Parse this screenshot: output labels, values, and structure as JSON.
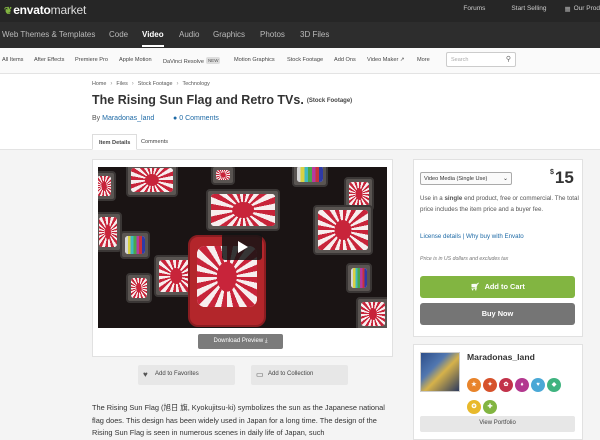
{
  "header": {
    "logo": "envato",
    "logo_suffix": "market",
    "links": [
      "Forums",
      "Start Selling",
      "Our Prod"
    ]
  },
  "categories": [
    "Web Themes & Templates",
    "Code",
    "Video",
    "Audio",
    "Graphics",
    "Photos",
    "3D Files"
  ],
  "active_category": "Video",
  "subnav": {
    "items": [
      "All Items",
      "After Effects",
      "Premiere Pro",
      "Apple Motion",
      "DaVinci Resolve",
      "Motion Graphics",
      "Stock Footage",
      "Add Ons",
      "Video Maker",
      "More"
    ],
    "new_badge": "NEW",
    "video_maker_suffix": "↗",
    "search_placeholder": "Search"
  },
  "breadcrumbs": [
    "Home",
    "Files",
    "Stock Footage",
    "Technology"
  ],
  "item": {
    "title": "The Rising Sun Flag and Retro TVs.",
    "subtag": "(Stock Footage)",
    "by_prefix": "By",
    "author": "Maradonas_land",
    "comments": "0 Comments"
  },
  "tabs": [
    "Item Details",
    "Comments"
  ],
  "preview": {
    "download_label": "Download Preview",
    "favorites_label": "Add to Favorites",
    "collection_label": "Add to Collection"
  },
  "description": "The Rising Sun Flag (旭日 旗, Kyokujitsu-ki) symbolizes the sun as the Japanese national flag does. This design has been widely used in Japan for a long time. The design of the Rising Sun Flag is seen in numerous scenes in daily life of Japan, such",
  "purchase": {
    "license": "Video Media (Single Use)",
    "currency": "$",
    "price": "15",
    "use_text_pre": "Use in a",
    "use_text_bold": "single",
    "use_text_post": "end product, free or commercial. The total price includes the item price and a buyer fee.",
    "license_links": "License details | Why buy with Envato",
    "note": "Price is in US dollars and excludes tax",
    "cart_label": "Add to Cart",
    "buy_label": "Buy Now"
  },
  "author_card": {
    "name": "Maradonas_land",
    "portfolio_label": "View Portfolio",
    "badge_colors": [
      "#e8842b",
      "#d6522b",
      "#c2324a",
      "#b3388f",
      "#4aa8d6",
      "#3fb37f",
      "#e8b92b",
      "#82b541"
    ]
  },
  "colors": {
    "accent_green": "#82b541",
    "link_blue": "#1e6aa6",
    "topbar": "#262626"
  }
}
